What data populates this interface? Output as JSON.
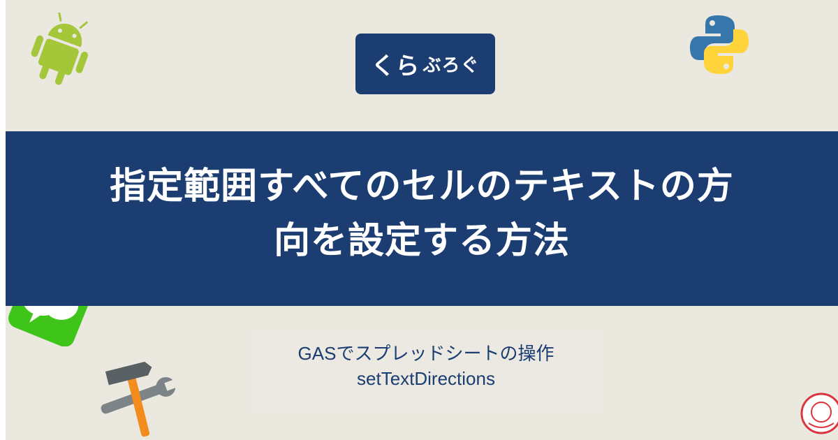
{
  "logo": {
    "part1": "くら",
    "part2": "ぶろぐ"
  },
  "title": {
    "line1": "指定範囲すべてのセルのテキストの方",
    "line2": "向を設定する方法"
  },
  "subtitle": {
    "line1": "GASでスプレッドシートの操作",
    "line2": "setTextDirections"
  },
  "colors": {
    "banner": "#1b3d72",
    "background": "#eae8df",
    "android": "#a4c639",
    "wechat": "#3fc51a",
    "hammer": "#f28c1c"
  },
  "icons": [
    "android-icon",
    "python-icon",
    "wechat-icon",
    "tools-icon",
    "docs-icon",
    "avatar-icon"
  ]
}
